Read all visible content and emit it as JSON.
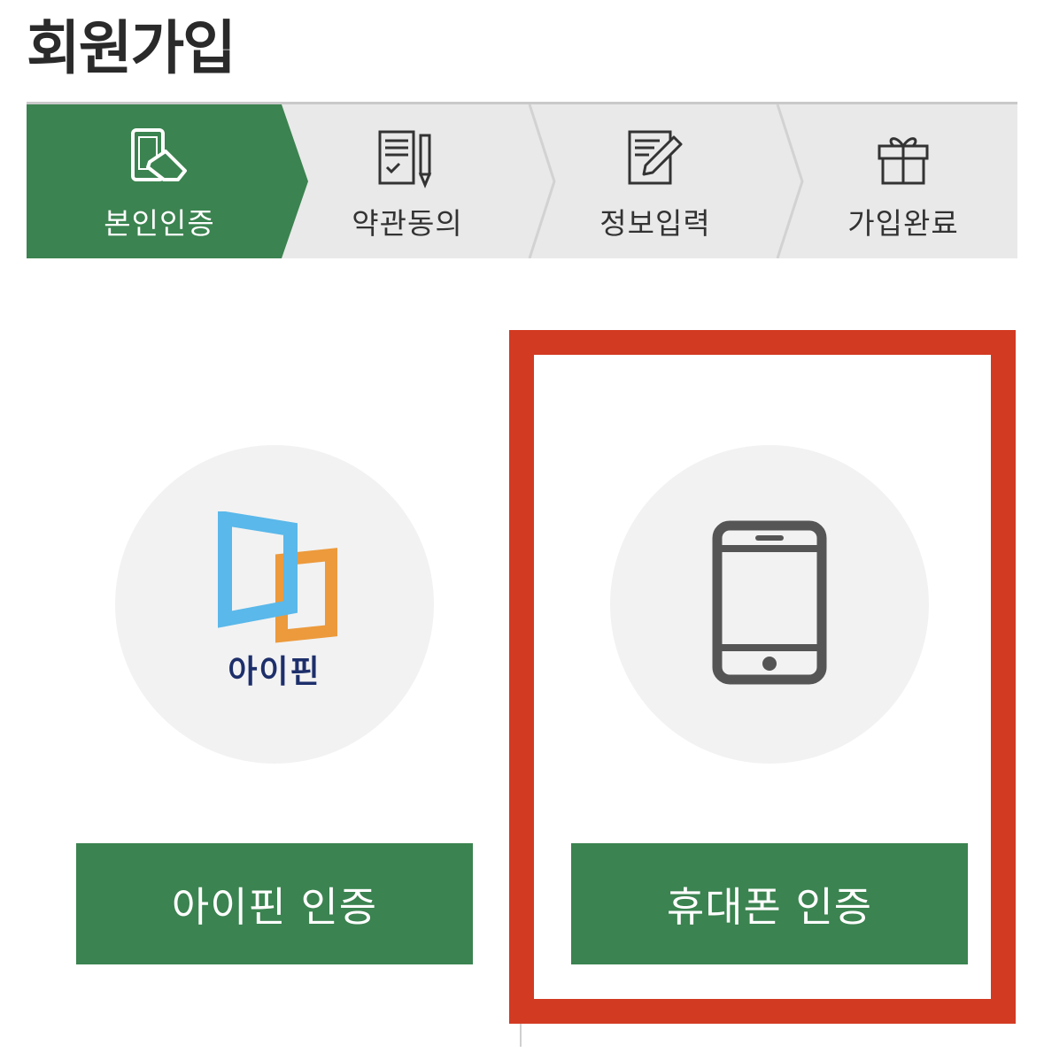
{
  "page": {
    "title": "회원가입"
  },
  "steps": [
    {
      "label": "본인인증",
      "icon": "touch-phone-icon",
      "active": true
    },
    {
      "label": "약관동의",
      "icon": "document-pencil-icon",
      "active": false
    },
    {
      "label": "정보입력",
      "icon": "edit-form-icon",
      "active": false
    },
    {
      "label": "가입완료",
      "icon": "gift-icon",
      "active": false
    }
  ],
  "options": {
    "ipin": {
      "logo_text": "아이핀",
      "icon": "ipin-logo",
      "button_label": "아이핀 인증"
    },
    "phone": {
      "icon": "smartphone-icon",
      "button_label": "휴대폰 인증"
    }
  },
  "colors": {
    "primary": "#3b8350",
    "highlight": "#d23a22",
    "step_bg": "#e9e9e9",
    "circle_bg": "#f2f2f2"
  }
}
